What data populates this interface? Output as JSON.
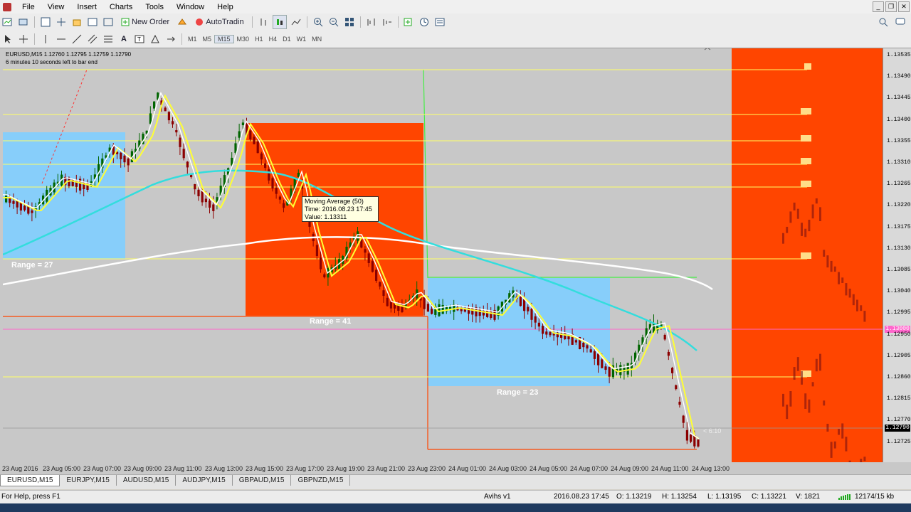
{
  "menu": {
    "items": [
      "File",
      "View",
      "Insert",
      "Charts",
      "Tools",
      "Window",
      "Help"
    ]
  },
  "toolbar": {
    "new_order": "New Order",
    "autotrading": "AutoTradin",
    "timeframes": [
      "M1",
      "M5",
      "M15",
      "M30",
      "H1",
      "H4",
      "D1",
      "W1",
      "MN"
    ],
    "active_timeframe": "M15"
  },
  "chart": {
    "symbol_info": "EURUSD,M15  1.12760 1.12795 1.12759 1.12790",
    "bar_timer": "6 minutes 10 seconds left to bar end",
    "price_labels": [
      "1.13535",
      "1.13490",
      "1.13445",
      "1.13400",
      "1.13355",
      "1.13310",
      "1.13265",
      "1.13220",
      "1.13175",
      "1.13130",
      "1.13085",
      "1.13040",
      "1.12995",
      "1.12950",
      "1.12905",
      "1.12860",
      "1.12815",
      "1.12770",
      "1.12725"
    ],
    "price_tag_pink": "1.13000",
    "price_tag_current": "1.12790",
    "time_labels": [
      "23 Aug 2016",
      "23 Aug 05:00",
      "23 Aug 07:00",
      "23 Aug 09:00",
      "23 Aug 11:00",
      "23 Aug 13:00",
      "23 Aug 15:00",
      "23 Aug 17:00",
      "23 Aug 19:00",
      "23 Aug 21:00",
      "23 Aug 23:00",
      "24 Aug 01:00",
      "24 Aug 03:00",
      "24 Aug 05:00",
      "24 Aug 07:00",
      "24 Aug 09:00",
      "24 Aug 11:00",
      "24 Aug 13:00"
    ],
    "range_labels": [
      "Range = 27",
      "Range = 41",
      "Range = 23"
    ],
    "countdown": "< 6:10",
    "tooltip": {
      "line1": "Moving Average (50)",
      "line2": "Time: 2016.08.23 17:45",
      "line3": "Value: 1.13311"
    },
    "colors": {
      "background": "#c8c8c8",
      "orange_box": "#ff4500",
      "blue_box": "#87cefa",
      "ma_fast": "#ffff33",
      "ma_mid": "#ffffff",
      "ma_50": "#33dddd",
      "ma_slow": "#ffffff",
      "bull": "#006400",
      "bear": "#8b0000",
      "yellow_level": "#ffff66",
      "pink_level": "#ff66cc"
    }
  },
  "tabs": [
    "EURUSD,M15",
    "EURJPY,M15",
    "AUDUSD,M15",
    "AUDJPY,M15",
    "GBPAUD,M15",
    "GBPNZD,M15"
  ],
  "status": {
    "help": "For Help, press F1",
    "profile": "Avihs v1",
    "datetime": "2016.08.23 17:45",
    "open": "O: 1.13219",
    "high": "H: 1.13254",
    "low": "L: 1.13195",
    "close": "C: 1.13221",
    "volume": "V: 1821",
    "traffic": "12174/15 kb"
  }
}
